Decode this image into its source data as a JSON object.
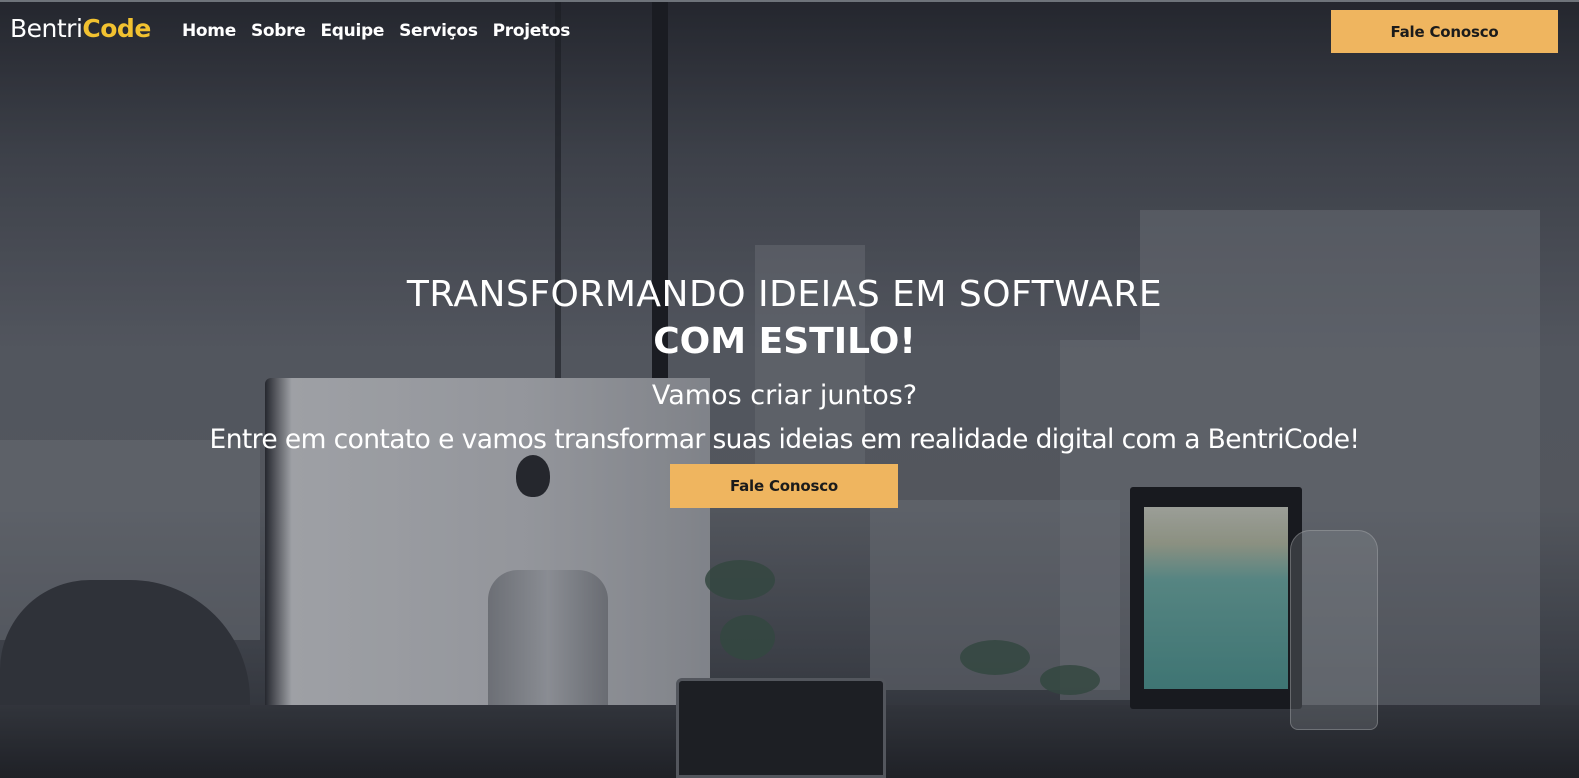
{
  "brand": {
    "name_part1": "Bentri",
    "name_part2": "Code",
    "accent_color": "#f2c230"
  },
  "nav": {
    "items": [
      {
        "label": "Home"
      },
      {
        "label": "Sobre"
      },
      {
        "label": "Equipe"
      },
      {
        "label": "Serviços"
      },
      {
        "label": "Projetos"
      }
    ]
  },
  "header": {
    "cta_label": "Fale Conosco"
  },
  "hero": {
    "title_line1": "TRANSFORMANDO IDEIAS EM SOFTWARE",
    "title_line2": "COM ESTILO!",
    "subtitle": "Vamos criar juntos?",
    "description": "Entre em contato e vamos transformar suas ideias em realidade digital com a BentriCode!",
    "cta_label": "Fale Conosco",
    "background_image": "office-desk-city-view"
  },
  "colors": {
    "button_bg": "#efb55f",
    "button_text": "#1b1b1b",
    "text": "#ffffff"
  }
}
